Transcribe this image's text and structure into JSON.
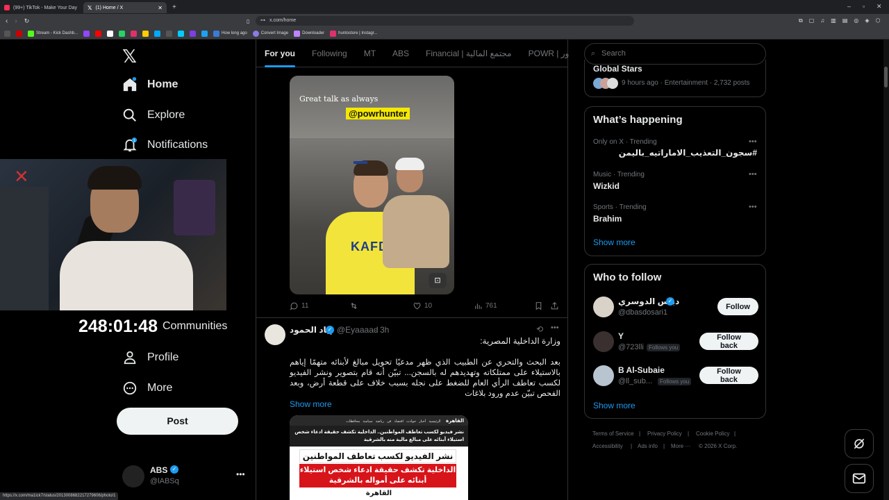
{
  "browser": {
    "tabs": [
      {
        "title": "(99+) TikTok - Make Your Day"
      },
      {
        "title": "(1) Home / X"
      }
    ],
    "url": "x.com/home",
    "bookmarks": [
      "Stream - Kick Dashb...",
      "How long ago",
      "Convert Image",
      "Downloader",
      "huntostore | Instagr..."
    ],
    "status_url": "https://x.com/ma1ick7/status/2013008682217279606/photo/1"
  },
  "nav": {
    "home": "Home",
    "explore": "Explore",
    "notifications": "Notifications",
    "communities": "Communities",
    "profile": "Profile",
    "more": "More",
    "post": "Post",
    "account_name": "ABS",
    "account_handle": "@lABSq"
  },
  "stream_timer": "248:01:48",
  "feed_tabs": [
    "For you",
    "Following",
    "MT",
    "ABS",
    "Financial | مجتمع المالية",
    "POWR | ور"
  ],
  "tweet1": {
    "image_caption": "Great talk as always",
    "image_tag": "@powrhunter",
    "jersey_text": "KAFD",
    "replies": "11",
    "likes": "10",
    "views": "761"
  },
  "tweet2": {
    "name": "إياد الحمود",
    "handle": "@Eyaaaad",
    "time": "3h",
    "line1": "وزارة الداخلية المصرية:",
    "body": "بعد البحث والتحري عن الطبيب الذي ظهر مدعيًا تحويل مبالغ لأبنائه متهمًا إياهم بالاستيلاء على ممتلكاته وتهديدهم له بالسجن... تبيّن أنه قام بتصوير ونشر الفيديو لكسب تعاطف الرأي العام للضغط على نجله بسبب خلاف على قطعة أرض، وبعد الفحص تبيّن عدم ورود بلاغات",
    "show_more": "Show more",
    "img_logo": "القاهرة",
    "img_headline": "نشر فيديو لكسب تعاطف المواطنين.. الداخلية تكشف حقيقة ادعاء شخص استيلاء أبنائه على مبالغ مالية منه بالشرقية",
    "img_box1": "نشر الفيديو لكسب تعاطف المواطنين",
    "img_box2": "الداخلية تكشف حقيقة ادعاء شخص استيلاء أبنائه على أمواله بالشرقية",
    "img_box3": "القاهرة",
    "img_menu": [
      "الرئيسية",
      "أخبار",
      "حوادث",
      "اقتصاد",
      "فن",
      "رياضة",
      "سياسة",
      "محافظات"
    ]
  },
  "right": {
    "search_placeholder": "Search",
    "event_title": "Global Stars",
    "event_meta": "9 hours ago · Entertainment · 2,732 posts",
    "happening_title": "What’s happening",
    "trends": [
      {
        "meta": "Only on X · Trending",
        "name": "#سجون_التعذيب_الاماراتيه_باليمن"
      },
      {
        "meta": "Music · Trending",
        "name": "Wizkid"
      },
      {
        "meta": "Sports · Trending",
        "name": "Brahim"
      }
    ],
    "show_more": "Show more",
    "who_title": "Who to follow",
    "who": [
      {
        "name": "دباس الدوسري",
        "handle": "@dbasdosari1",
        "button": "Follow",
        "follows_you": ""
      },
      {
        "name": "Y",
        "handle": "@723lli",
        "button": "Follow back",
        "follows_you": "Follows you"
      },
      {
        "name": "B Al-Subaie",
        "handle": "@ll_sub...",
        "button": "Follow back",
        "follows_you": "Follows you"
      }
    ],
    "who_show_more": "Show more",
    "footer": [
      "Terms of Service",
      "Privacy Policy",
      "Cookie Policy",
      "Accessibility",
      "Ads info",
      "More ···",
      "© 2026 X Corp."
    ]
  },
  "colors": {
    "accent": "#1d9bf0",
    "background": "#000000",
    "border": "#2f3336",
    "muted": "#71767b"
  }
}
